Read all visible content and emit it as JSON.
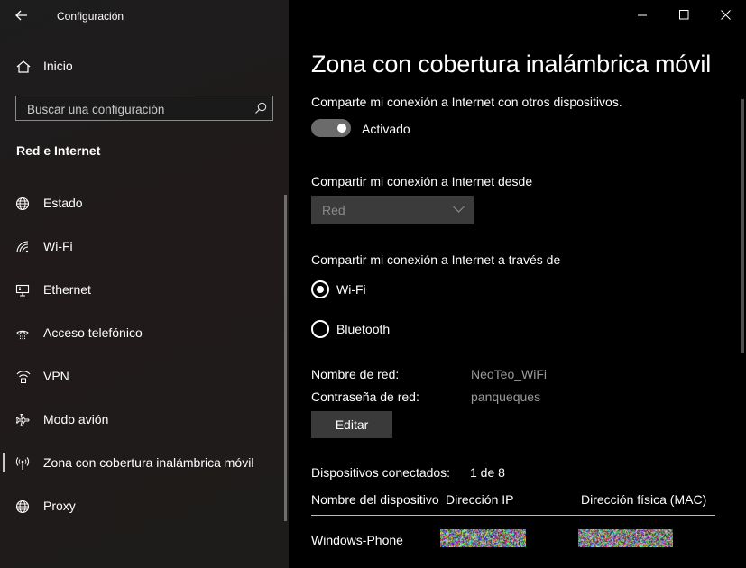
{
  "app_title": "Configuración",
  "sidebar": {
    "home_label": "Inicio",
    "search_placeholder": "Buscar una configuración",
    "section_title": "Red e Internet",
    "items": [
      {
        "label": "Estado",
        "icon": "globe-icon"
      },
      {
        "label": "Wi-Fi",
        "icon": "wifi-icon"
      },
      {
        "label": "Ethernet",
        "icon": "ethernet-icon"
      },
      {
        "label": "Acceso telefónico",
        "icon": "dialup-icon"
      },
      {
        "label": "VPN",
        "icon": "vpn-icon"
      },
      {
        "label": "Modo avión",
        "icon": "airplane-icon"
      },
      {
        "label": "Zona con cobertura inalámbrica móvil",
        "icon": "hotspot-icon",
        "active": true
      },
      {
        "label": "Proxy",
        "icon": "globe-icon"
      }
    ]
  },
  "main": {
    "title": "Zona con cobertura inalámbrica móvil",
    "share_desc": "Comparte mi conexión a Internet con otros dispositivos.",
    "toggle_state": "Activado",
    "share_from_label": "Compartir mi conexión a Internet desde",
    "share_from_value": "Red",
    "share_via_label": "Compartir mi conexión a Internet a través de",
    "options": [
      {
        "label": "Wi-Fi",
        "selected": true
      },
      {
        "label": "Bluetooth",
        "selected": false
      }
    ],
    "network_name_label": "Nombre de red:",
    "network_name_value": "NeoTeo_WiFi",
    "password_label": "Contraseña de red:",
    "password_value": "panqueques",
    "edit_button": "Editar",
    "connected_label": "Dispositivos conectados:",
    "connected_value": "1 de 8",
    "table": {
      "headers": [
        "Nombre del dispositivo",
        "Dirección IP",
        "Dirección física (MAC)"
      ],
      "rows": [
        {
          "device": "Windows-Phone",
          "ip": "",
          "mac": ""
        }
      ]
    }
  },
  "colors": {
    "accent": "#ffffff",
    "toggle_track": "#6b6b6b",
    "dropdown_bg": "#3b3b3b",
    "button_bg": "#3a3a3a"
  }
}
